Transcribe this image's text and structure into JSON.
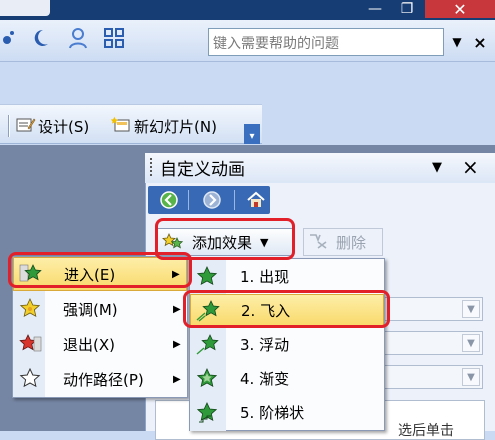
{
  "window": {
    "minimize": "—",
    "maximize": "❐",
    "close": "✕"
  },
  "help": {
    "placeholder": "键入需要帮助的问题",
    "arrow": "▼",
    "close": "×"
  },
  "toolbar2": {
    "design": "设计(S)",
    "new_slide": "新幻灯片(N)"
  },
  "pane": {
    "title": "自定义动画",
    "dropdown": "▼",
    "close": "×",
    "add_effect": "添加效果",
    "add_effect_arrow": "▼",
    "remove": "删除",
    "hint": "选后单击"
  },
  "menu": {
    "items": [
      {
        "label": "进入(E)",
        "arrow": "▶"
      },
      {
        "label": "强调(M)",
        "arrow": "▶"
      },
      {
        "label": "退出(X)",
        "arrow": "▶"
      },
      {
        "label": "动作路径(P)",
        "arrow": "▶"
      }
    ]
  },
  "submenu": {
    "items": [
      {
        "label": "1. 出现"
      },
      {
        "label": "2. 飞入"
      },
      {
        "label": "3. 浮动"
      },
      {
        "label": "4. 渐变"
      },
      {
        "label": "5. 阶梯状"
      }
    ]
  },
  "colors": {
    "accent": "#3769b5",
    "highlight": "#f9d96a",
    "annotation": "#e2202a"
  }
}
